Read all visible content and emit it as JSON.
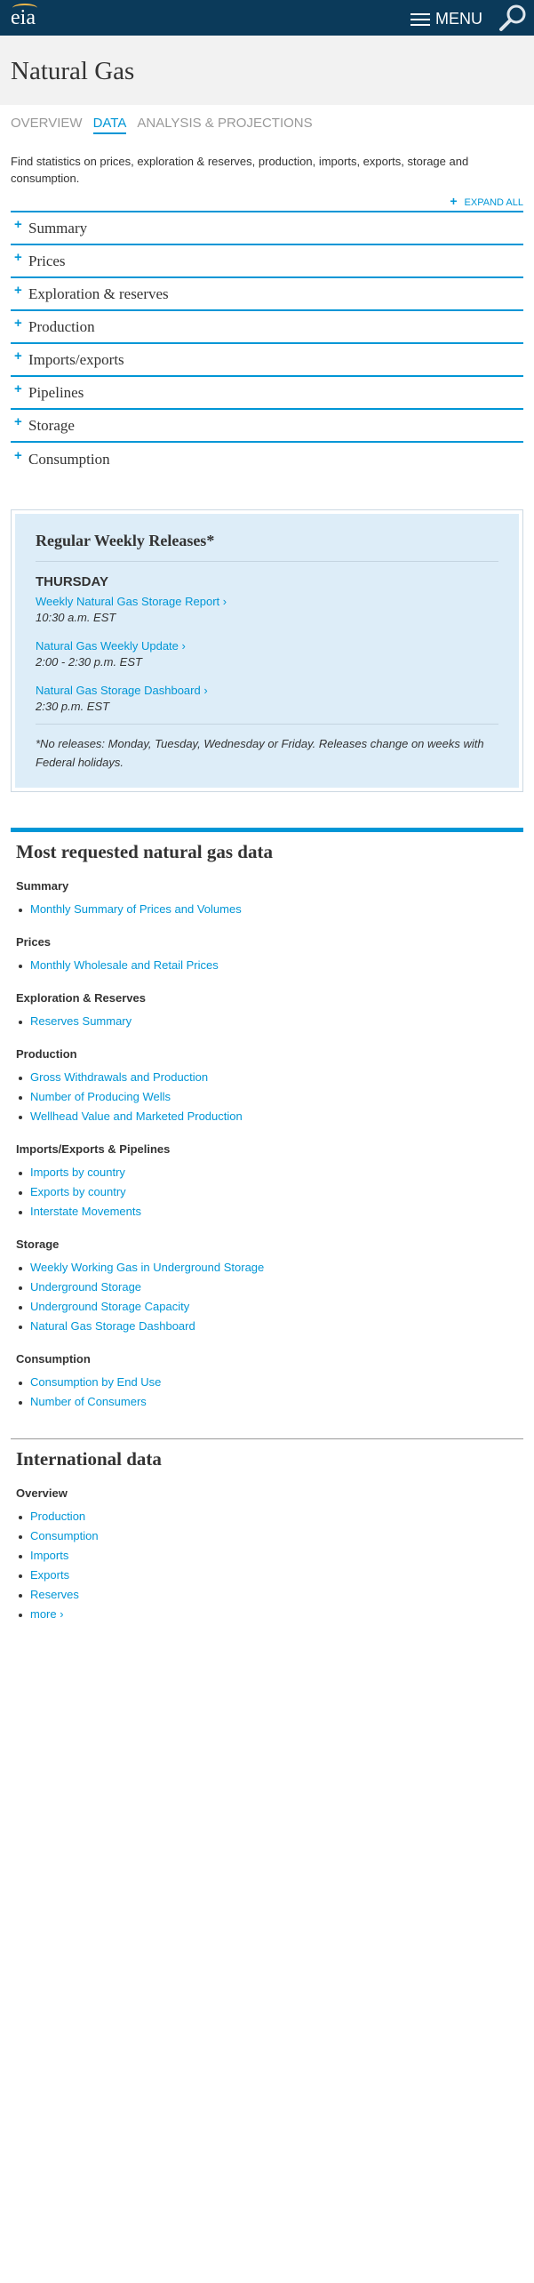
{
  "header": {
    "logo": "eia",
    "menu_label": "MENU"
  },
  "page": {
    "title": "Natural Gas"
  },
  "tabs": [
    {
      "label": "OVERVIEW"
    },
    {
      "label": "DATA"
    },
    {
      "label": "ANALYSIS & PROJECTIONS"
    }
  ],
  "intro": "Find statistics on prices, exploration & reserves, production, imports, exports, storage and consumption.",
  "expand_all": "EXPAND ALL",
  "accordion": [
    {
      "label": "Summary"
    },
    {
      "label": "Prices"
    },
    {
      "label": "Exploration & reserves"
    },
    {
      "label": "Production"
    },
    {
      "label": "Imports/exports"
    },
    {
      "label": "Pipelines"
    },
    {
      "label": "Storage"
    },
    {
      "label": "Consumption"
    }
  ],
  "releases": {
    "title": "Regular Weekly Releases*",
    "day": "THURSDAY",
    "items": [
      {
        "link": "Weekly Natural Gas Storage Report ›",
        "time": "10:30 a.m. EST"
      },
      {
        "link": "Natural Gas Weekly Update ›",
        "time": "2:00 - 2:30 p.m. EST"
      },
      {
        "link": "Natural Gas Storage Dashboard ›",
        "time": "2:30 p.m. EST"
      }
    ],
    "note": "*No releases: Monday, Tuesday, Wednesday or Friday. Releases change on weeks with Federal holidays."
  },
  "requested": {
    "title": "Most requested natural gas data",
    "groups": [
      {
        "heading": "Summary",
        "links": [
          "Monthly Summary of Prices and Volumes"
        ]
      },
      {
        "heading": "Prices",
        "links": [
          "Monthly Wholesale and Retail Prices"
        ]
      },
      {
        "heading": "Exploration & Reserves",
        "links": [
          "Reserves Summary"
        ]
      },
      {
        "heading": "Production",
        "links": [
          "Gross Withdrawals and Production",
          "Number of Producing Wells",
          "Wellhead Value and Marketed Production"
        ]
      },
      {
        "heading": "Imports/Exports & Pipelines",
        "links": [
          "Imports by country",
          "Exports by country",
          "Interstate Movements"
        ]
      },
      {
        "heading": "Storage",
        "links": [
          "Weekly Working Gas in Underground Storage",
          "Underground Storage",
          "Underground Storage Capacity",
          "Natural Gas Storage Dashboard"
        ]
      },
      {
        "heading": "Consumption",
        "links": [
          "Consumption by End Use",
          "Number of Consumers"
        ]
      }
    ]
  },
  "international": {
    "title": "International data",
    "heading": "Overview",
    "links": [
      "Production",
      "Consumption",
      "Imports",
      "Exports",
      "Reserves",
      "more ›"
    ]
  },
  "colors": {
    "header_bg": "#0b3a5a",
    "accent": "#0096d6",
    "release_bg": "#ddedf8"
  }
}
